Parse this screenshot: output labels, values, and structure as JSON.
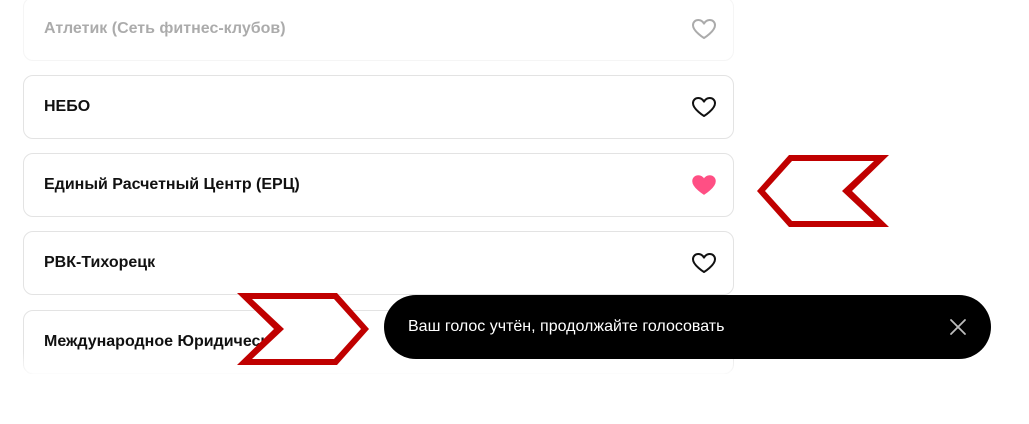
{
  "list": {
    "items": [
      {
        "label": "Атлетик (Сеть фитнес-клубов)",
        "liked": false,
        "faded": true
      },
      {
        "label": "НЕБО",
        "liked": false,
        "faded": false
      },
      {
        "label": "Единый Расчетный Центр (ЕРЦ)",
        "liked": true,
        "faded": false
      },
      {
        "label": "РВК-Тихорецк",
        "liked": false,
        "faded": false
      },
      {
        "label": "Международное Юридическое Бюро",
        "liked": false,
        "faded": false
      }
    ]
  },
  "toast": {
    "message": "Ваш голос учтён, продолжайте голосовать"
  },
  "icons": {
    "heart_outline": "heart-outline-icon",
    "heart_filled": "heart-filled-icon",
    "close": "close-icon",
    "annotation_arrow": "red-arrow-annotation"
  },
  "colors": {
    "heart_filled": "#ff4f84",
    "annotation": "#c00000",
    "toast_bg": "#000000"
  }
}
